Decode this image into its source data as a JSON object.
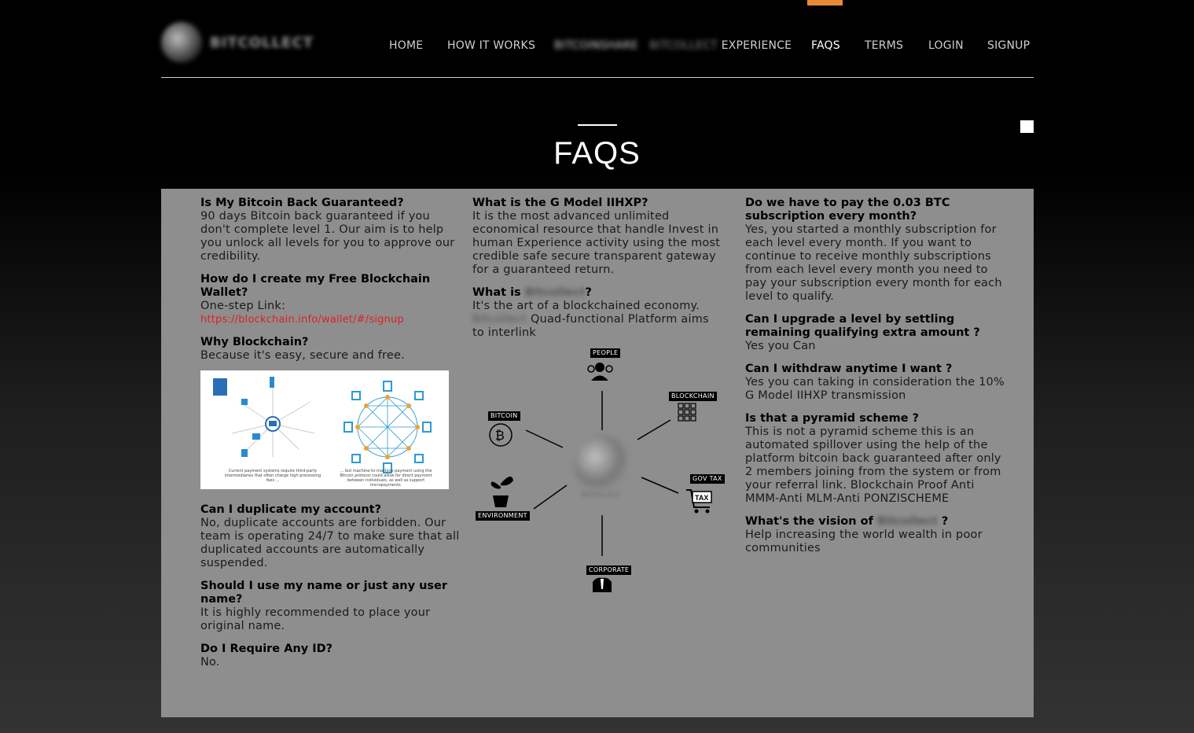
{
  "brand": {
    "name": "BITCOLLECT"
  },
  "nav": {
    "home": "HOME",
    "how_it_works": "HOW IT WORKS",
    "bitcoin_share": "BITCOINSHARE",
    "experience_prefix": "BITCOLLECT",
    "experience": "EXPERIENCE",
    "faqs": "FAQS",
    "terms": "TERMS",
    "login": "LOGIN",
    "signup": "SIGNUP"
  },
  "page_title": "FAQS",
  "faqs_col1": [
    {
      "q": "Is My Bitcoin Back Guaranteed?",
      "a": "90 days Bitcoin back guaranteed if you don't complete level 1. Our aim is to help you unlock all levels for you to approve our credibility."
    },
    {
      "q": "How do I create my Free Blockchain Wallet?",
      "a": "One-step Link: ",
      "link": "https://blockchain.info/wallet/#/signup"
    },
    {
      "q": "Why Blockchain?",
      "a": "Because it's easy, secure and free."
    },
    {
      "q": "Can I duplicate my account?",
      "a": "No, duplicate accounts are forbidden. Our team is operating 24/7 to make sure that all duplicated accounts are automatically suspended."
    },
    {
      "q": "Should I use my name or just any user name?",
      "a": "It is highly recommended to place your original name."
    },
    {
      "q": "Do I Require Any ID?",
      "a": "No."
    }
  ],
  "blockchain_image": {
    "caption_left": "Current payment systems require third-party intermediaries that often charge high processing fees ...",
    "caption_right": "... but machine-to-machine payment using the Bitcoin protocol could allow for direct payment between individuals, as well as support micropayments."
  },
  "faqs_col2": [
    {
      "q": "What is the G Model IIHXP?",
      "a": "It is the most advanced unlimited economical resource that handle Invest in human Experience activity using the most credible safe secure transparent gateway for a guaranteed return."
    },
    {
      "q_prefix": "What is ",
      "q_blur": "Bitcollect",
      "q_suffix": "?",
      "a_line1": "It's the art of a blockchained economy.",
      "a_blur": "Bitcollect",
      "a_line2": " Quad-functional Platform aims to interlink"
    }
  ],
  "diagram": {
    "people": "PEOPLE",
    "blockchain": "BLOCKCHAIN",
    "bitcoin": "BITCOIN",
    "gov_tax": "GOV TAX",
    "environment": "ENVIRONMENT",
    "corporate": "CORPORATE",
    "center": "BITCOLLECT"
  },
  "faqs_col3": [
    {
      "q": "Do we have to pay the 0.03 BTC subscription every month?",
      "a": "Yes, you started a monthly subscription for each level every month. If you want to continue to receive monthly subscriptions from each level every month you need to pay your subscription every month for each level to qualify."
    },
    {
      "q": "Can I upgrade a level by settling remaining qualifying extra amount ?",
      "a": "Yes you Can"
    },
    {
      "q": "Can I withdraw anytime I want ?",
      "a": "Yes you can taking in consideration the 10% G Model IIHXP transmission"
    },
    {
      "q": "Is that a pyramid scheme ?",
      "a": "This is not a pyramid scheme this is an automated spillover using the help of the platform bitcoin back guaranteed after only 2 members joining from the system or from your referral link. Blockchain Proof Anti MMM-Anti MLM-Anti PONZISCHEME"
    },
    {
      "q_prefix": "What's the vision of ",
      "q_blur": "Bitcollect",
      "q_suffix": " ?",
      "a": "Help increasing the world wealth in poor communities"
    }
  ],
  "colors": {
    "accent": "#e8893a",
    "panel": "#8e8e8e",
    "link": "#e02020"
  }
}
